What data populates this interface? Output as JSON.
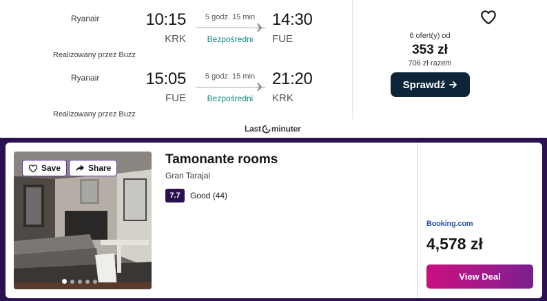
{
  "flight": {
    "legs": [
      {
        "airline": "Ryanair",
        "dep_time": "10:15",
        "dep_code": "KRK",
        "duration": "5 godz. 15 min",
        "stops": "Bezpośredni",
        "arr_time": "14:30",
        "arr_code": "FUE",
        "operated_by": "Realizowany przez Buzz"
      },
      {
        "airline": "Ryanair",
        "dep_time": "15:05",
        "dep_code": "FUE",
        "duration": "5 godz. 15 min",
        "stops": "Bezpośredni",
        "arr_time": "21:20",
        "arr_code": "KRK",
        "operated_by": "Realizowany przez Buzz"
      }
    ],
    "offers": "6 ofert(y) od",
    "price": "353 zł",
    "total": "706 zł razem",
    "cta_label": "Sprawdź",
    "provider_logo": {
      "before": "Last",
      "after": "minuter"
    },
    "icons": {
      "favorite": "heart-icon",
      "plane": "plane-icon",
      "cta": "arrow-right-icon"
    },
    "colors": {
      "cta_bg": "#0d2538",
      "direct_text": "#0b8a7e"
    }
  },
  "hotel": {
    "name": "Tamonante rooms",
    "location": "Gran Tarajal",
    "rating_score": "7.7",
    "rating_text": "Good (44)",
    "save_label": "Save",
    "share_label": "Share",
    "provider": "Booking.com",
    "price": "4,578 zł",
    "cta_label": "View Deal",
    "photo_count": 5,
    "photo_active_index": 0,
    "icons": {
      "save": "heart-icon",
      "share": "share-arrow-icon"
    },
    "colors": {
      "band": "#2b1150",
      "rating_bg": "#2b1150",
      "cta_start": "#c9107e",
      "cta_end": "#7a1e8e",
      "provider": "#2a4fa8"
    }
  }
}
